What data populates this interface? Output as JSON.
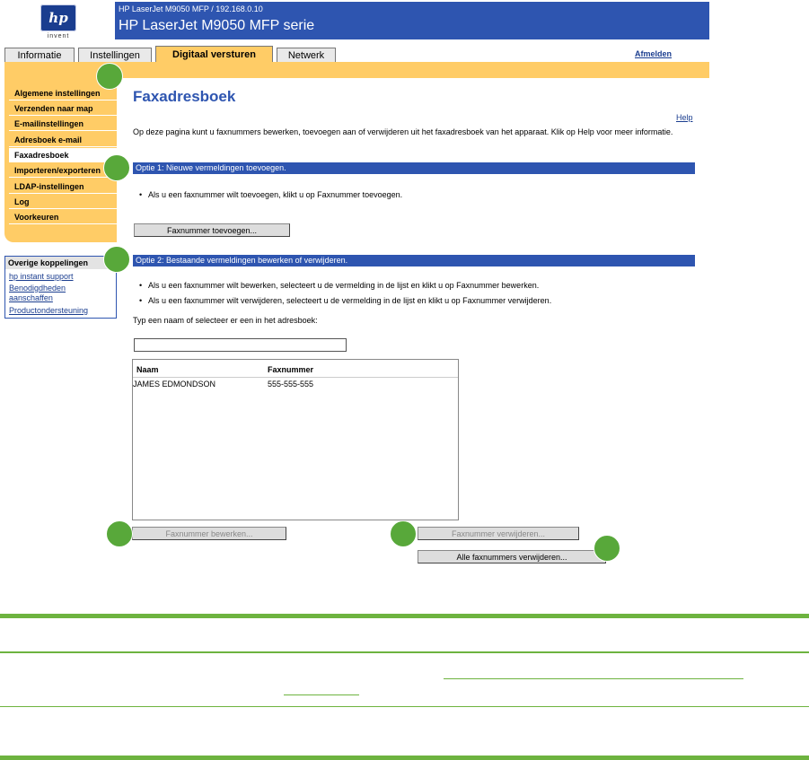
{
  "logo": {
    "text": "hp",
    "sub": "invent"
  },
  "header": {
    "subtitle": "HP LaserJet M9050 MFP / 192.168.0.10",
    "title": "HP LaserJet M9050 MFP serie"
  },
  "tabs": [
    {
      "label": "Informatie"
    },
    {
      "label": "Instellingen"
    },
    {
      "label": "Digitaal versturen"
    },
    {
      "label": "Netwerk"
    }
  ],
  "signout": "Afmelden",
  "nav": [
    {
      "label": "Algemene instellingen"
    },
    {
      "label": "Verzenden naar map"
    },
    {
      "label": "E-mailinstellingen"
    },
    {
      "label": "Adresboek e-mail"
    },
    {
      "label": "Faxadresboek"
    },
    {
      "label": "Importeren/exporteren"
    },
    {
      "label": "LDAP-instellingen"
    },
    {
      "label": "Log"
    },
    {
      "label": "Voorkeuren"
    }
  ],
  "other_links": {
    "heading": "Overige koppelingen",
    "items": [
      {
        "label": "hp instant support"
      },
      {
        "label": "Benodigdheden"
      },
      {
        "label": "aanschaffen"
      },
      {
        "label": "Productondersteuning"
      }
    ]
  },
  "main": {
    "title": "Faxadresboek",
    "help": "Help",
    "intro": "Op deze pagina kunt u faxnummers bewerken, toevoegen aan of verwijderen uit het faxadresboek van het apparaat. Klik op Help voor meer informatie.",
    "option1": {
      "title": "Optie 1: Nieuwe vermeldingen toevoegen.",
      "bullet": "Als u een faxnummer wilt toevoegen, klikt u op Faxnummer toevoegen.",
      "button": "Faxnummer toevoegen..."
    },
    "option2": {
      "title": "Optie 2: Bestaande vermeldingen bewerken of verwijderen.",
      "bullets": [
        "Als u een faxnummer wilt bewerken, selecteert u de vermelding in de lijst en klikt u op Faxnummer bewerken.",
        "Als u een faxnummer wilt verwijderen, selecteert u de vermelding in de lijst en klikt u op Faxnummer verwijderen."
      ],
      "search_label": "Typ een naam of selecteer er een in het adresboek:",
      "search_value": "",
      "columns": [
        "Naam",
        "Faxnummer"
      ],
      "rows": [
        {
          "name": "JAMES EDMONDSON",
          "fax": "555-555-555"
        }
      ],
      "edit_button": "Faxnummer bewerken...",
      "delete_button": "Faxnummer verwijderen...",
      "delete_all_button": "Alle faxnummers verwijderen..."
    }
  },
  "colors": {
    "header_blue": "#2e55b0",
    "tab_gold": "#ffcc66",
    "callout_green": "#58a83a",
    "rule_green": "#6db33f"
  }
}
